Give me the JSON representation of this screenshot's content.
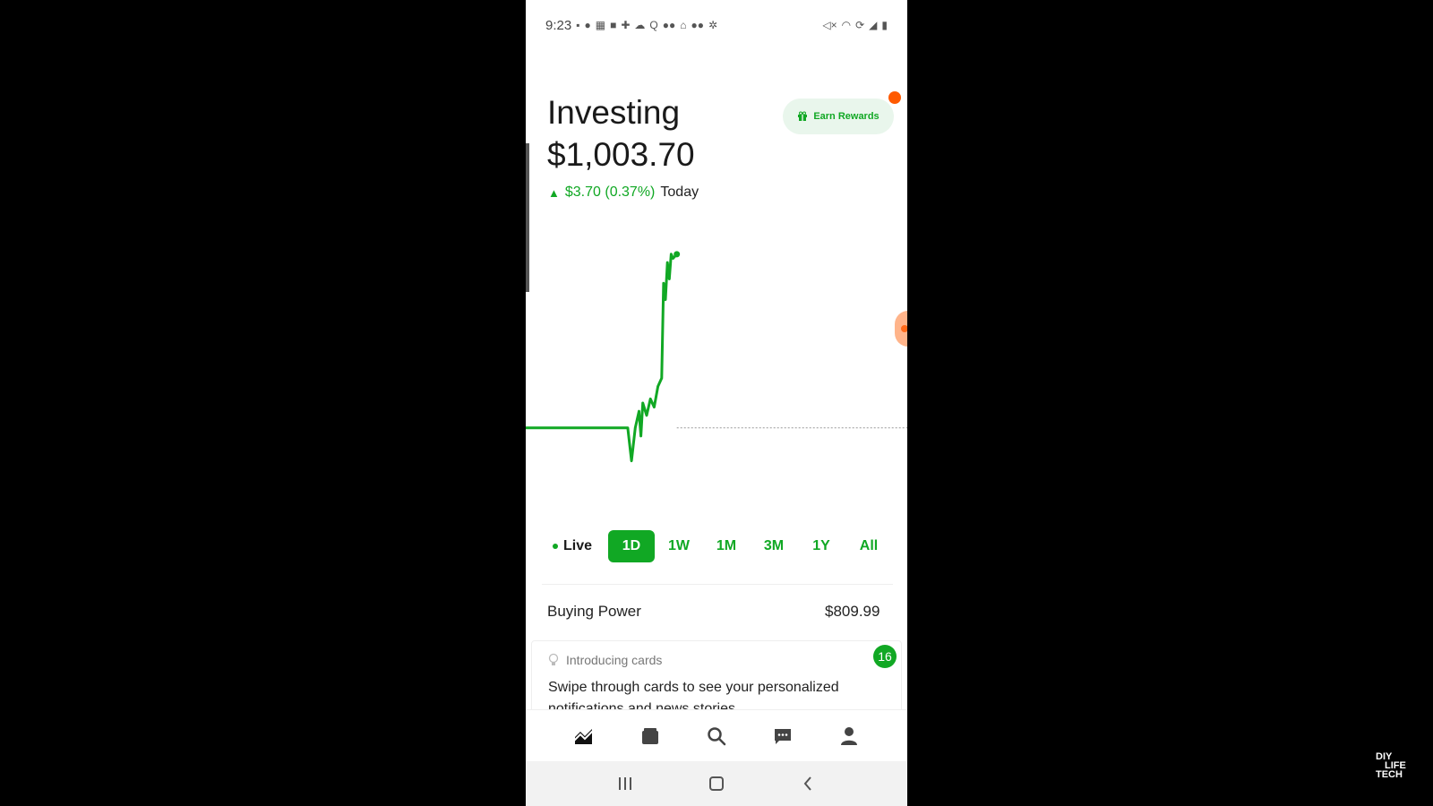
{
  "status_bar": {
    "time": "9:23",
    "left_icons": [
      "message-icon",
      "account-icon",
      "calendar-icon",
      "video-icon",
      "plus-grid-icon",
      "cloud-icon",
      "search-q-icon",
      "dots-icon",
      "home-icon",
      "dots-icon",
      "settings-icon"
    ],
    "right_icons": [
      "mute-icon",
      "wifi-icon",
      "sync-icon",
      "signal-icon",
      "battery-icon"
    ]
  },
  "header": {
    "title": "Investing",
    "balance": "$1,003.70",
    "change_amount": "$3.70 (0.37%)",
    "change_period": "Today"
  },
  "earn_rewards": {
    "label": "Earn Rewards",
    "icon": "gift-icon"
  },
  "chart_data": {
    "type": "line",
    "title": "",
    "xlabel": "",
    "ylabel": "",
    "ylim": [
      998,
      1004.5
    ],
    "baseline": 1000.0,
    "x": [
      0,
      10,
      20,
      27,
      28,
      29,
      30,
      30.5,
      31,
      32,
      33,
      34,
      35,
      36,
      36.5,
      37,
      37.5,
      38,
      38.5,
      39,
      40
    ],
    "values": [
      1000.0,
      1000.0,
      1000.0,
      1000.0,
      999.2,
      1000.0,
      1000.4,
      999.8,
      1000.6,
      1000.3,
      1000.7,
      1000.5,
      1001.0,
      1001.2,
      1003.5,
      1003.1,
      1004.0,
      1003.6,
      1004.2,
      1004.1,
      1004.2
    ],
    "color": "#11a824"
  },
  "ranges": {
    "live_label": "Live",
    "items": [
      "1D",
      "1W",
      "1M",
      "3M",
      "1Y",
      "All"
    ],
    "active": "1D"
  },
  "buying_power": {
    "label": "Buying Power",
    "value": "$809.99"
  },
  "card": {
    "heading": "Introducing cards",
    "body": "Swipe through cards to see your personalized notifications and news stories",
    "badge": "16"
  },
  "tabs": [
    "portfolio-icon",
    "wallet-icon",
    "search-icon",
    "messages-icon",
    "profile-icon"
  ],
  "colors": {
    "accent": "#11a824",
    "notification": "#ff5a00"
  },
  "watermark": [
    "DIY",
    "LIFE",
    "TECH"
  ]
}
